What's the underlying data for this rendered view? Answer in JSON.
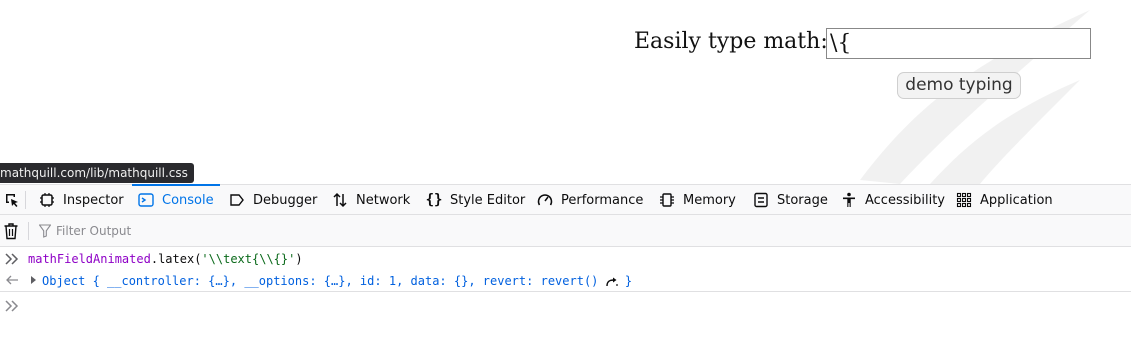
{
  "page": {
    "math_label": "Easily type math:",
    "math_field_value": "\\{",
    "demo_button_label": "demo typing",
    "url_tooltip": "mathquill.com/lib/mathquill.css"
  },
  "devtools": {
    "tabs": [
      {
        "label": "Inspector",
        "icon": "inspector-icon"
      },
      {
        "label": "Console",
        "icon": "console-icon",
        "active": true
      },
      {
        "label": "Debugger",
        "icon": "debugger-icon"
      },
      {
        "label": "Network",
        "icon": "network-icon"
      },
      {
        "label": "Style Editor",
        "icon": "style-editor-icon"
      },
      {
        "label": "Performance",
        "icon": "performance-icon"
      },
      {
        "label": "Memory",
        "icon": "memory-icon"
      },
      {
        "label": "Storage",
        "icon": "storage-icon"
      },
      {
        "label": "Accessibility",
        "icon": "accessibility-icon"
      },
      {
        "label": "Application",
        "icon": "application-icon"
      }
    ],
    "filter_placeholder": "Filter Output",
    "accent_color": "#0074e8"
  },
  "console": {
    "input_line": {
      "ident": "mathFieldAnimated",
      "dot": ".",
      "method": "latex",
      "open": "(",
      "arg": "'\\\\text{\\\\{}'",
      "close": ")"
    },
    "output_line": {
      "p1": "Object { ",
      "k1": "__controller",
      "p2": ": {…}, ",
      "k2": "__options",
      "p3": ": {…}, ",
      "k3": "id",
      "p4": ": ",
      "v3": "1",
      "p5": ", ",
      "k4": "data",
      "p6": ": {}, ",
      "k5": "revert",
      "p7": ": revert() ",
      "p8": " }"
    }
  }
}
